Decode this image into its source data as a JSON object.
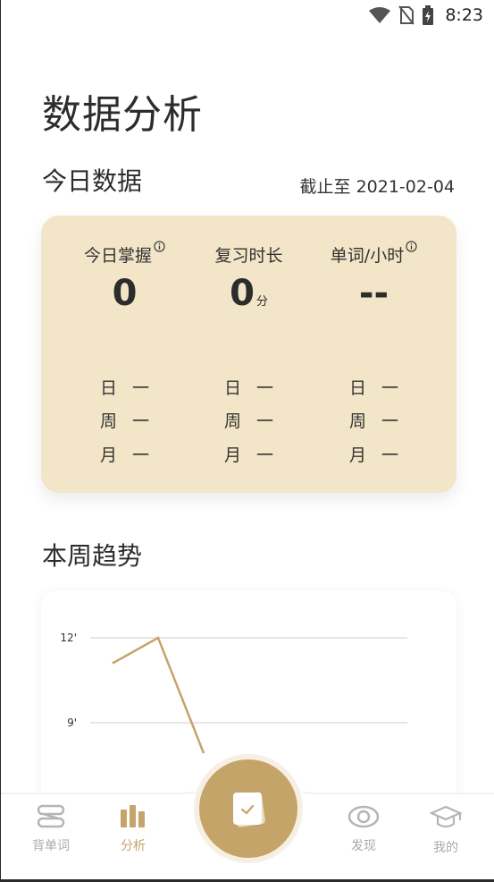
{
  "status_bar": {
    "time": "8:23"
  },
  "page_title": "数据分析",
  "today": {
    "title": "今日数据",
    "date_label": "截止至 2021-02-04",
    "stats": [
      {
        "label": "今日掌握",
        "value": "0",
        "unit": "",
        "has_info": true,
        "rows": [
          {
            "k": "日",
            "v": "一"
          },
          {
            "k": "周",
            "v": "一"
          },
          {
            "k": "月",
            "v": "一"
          }
        ]
      },
      {
        "label": "复习时长",
        "value": "0",
        "unit": "分",
        "has_info": false,
        "rows": [
          {
            "k": "日",
            "v": "一"
          },
          {
            "k": "周",
            "v": "一"
          },
          {
            "k": "月",
            "v": "一"
          }
        ]
      },
      {
        "label": "单词/小时",
        "value": "--",
        "unit": "",
        "has_info": true,
        "rows": [
          {
            "k": "日",
            "v": "一"
          },
          {
            "k": "周",
            "v": "一"
          },
          {
            "k": "月",
            "v": "一"
          }
        ]
      }
    ]
  },
  "week": {
    "title": "本周趋势"
  },
  "chart_data": {
    "type": "line",
    "y_ticks": [
      "12'",
      "9'"
    ],
    "y_tick_values": [
      12,
      9
    ],
    "x": [
      0,
      1,
      2
    ],
    "values": [
      11.1,
      12,
      8.0
    ],
    "ylim": [
      7.5,
      12
    ],
    "grid": true,
    "color": "#c5a46a"
  },
  "nav": {
    "items": [
      {
        "label": "背单词",
        "icon": "cards-icon"
      },
      {
        "label": "分析",
        "icon": "bar-chart-icon"
      },
      {
        "label": "发现",
        "icon": "eye-icon"
      },
      {
        "label": "我的",
        "icon": "graduation-cap-icon"
      }
    ],
    "active_color": "#c5a46a",
    "inactive_color": "#aaaaaa"
  }
}
